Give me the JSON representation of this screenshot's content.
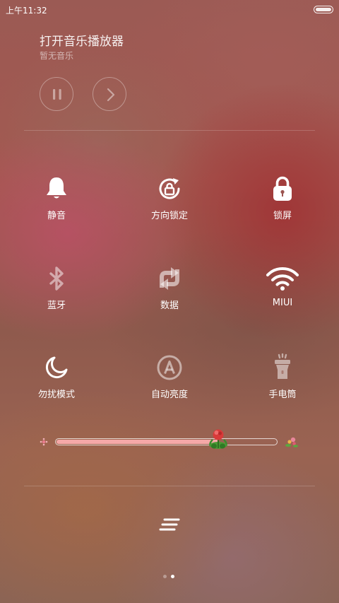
{
  "status_bar": {
    "time": "上午11:32",
    "battery_icon": "battery-icon"
  },
  "music": {
    "title": "打开音乐播放器",
    "subtitle": "暂无音乐",
    "controls": [
      "pause-icon",
      "next-icon"
    ]
  },
  "toggles": [
    {
      "label": "静音",
      "icon": "bell-icon",
      "active": true
    },
    {
      "label": "方向锁定",
      "icon": "rotation-lock-icon",
      "active": true
    },
    {
      "label": "锁屏",
      "icon": "lock-icon",
      "active": true
    },
    {
      "label": "蓝牙",
      "icon": "bluetooth-icon",
      "active": false
    },
    {
      "label": "数据",
      "icon": "data-arrows-icon",
      "active": false
    },
    {
      "label": "MIUI",
      "icon": "wifi-icon",
      "active": true
    },
    {
      "label": "勿扰模式",
      "icon": "moon-icon",
      "active": true
    },
    {
      "label": "自动亮度",
      "icon": "auto-brightness-icon",
      "active": false
    },
    {
      "label": "手电筒",
      "icon": "flashlight-icon",
      "active": false
    }
  ],
  "brightness": {
    "level": 0.74,
    "fill_color": "#f5a8a8"
  },
  "pager": {
    "pages": 2,
    "current": 2
  }
}
